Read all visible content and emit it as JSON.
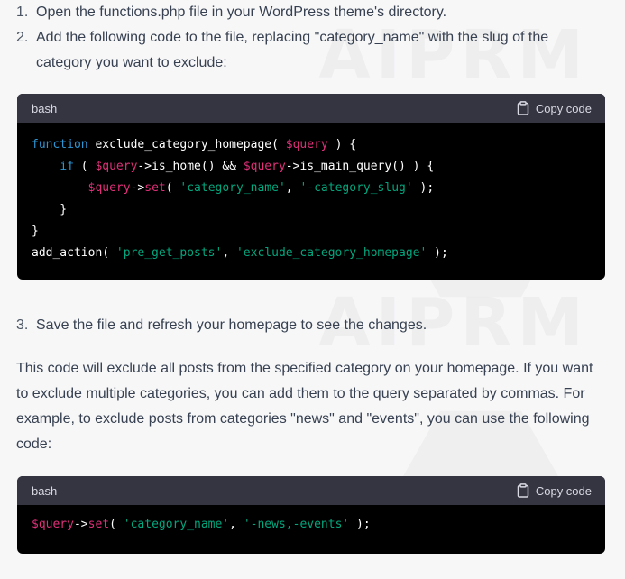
{
  "steps_top": [
    {
      "num": "1.",
      "text": "Open the functions.php file in your WordPress theme's directory."
    },
    {
      "num": "2.",
      "text": "Add the following code to the file, replacing \"category_name\" with the slug of the category you want to exclude:"
    }
  ],
  "code_block_1": {
    "lang": "bash",
    "copy_label": "Copy code",
    "lines": [
      [
        {
          "t": "k",
          "v": "function"
        },
        {
          "t": "p",
          "v": " exclude_category_homepage( "
        },
        {
          "t": "v",
          "v": "$query"
        },
        {
          "t": "p",
          "v": " ) {"
        }
      ],
      [
        {
          "t": "p",
          "v": "    "
        },
        {
          "t": "k",
          "v": "if"
        },
        {
          "t": "p",
          "v": " ( "
        },
        {
          "t": "v",
          "v": "$query"
        },
        {
          "t": "p",
          "v": "->is_home() && "
        },
        {
          "t": "v",
          "v": "$query"
        },
        {
          "t": "p",
          "v": "->is_main_query() ) {"
        }
      ],
      [
        {
          "t": "p",
          "v": "        "
        },
        {
          "t": "v",
          "v": "$query"
        },
        {
          "t": "p",
          "v": "->"
        },
        {
          "t": "v",
          "v": "set"
        },
        {
          "t": "p",
          "v": "( "
        },
        {
          "t": "s",
          "v": "'category_name'"
        },
        {
          "t": "p",
          "v": ", "
        },
        {
          "t": "s",
          "v": "'-category_slug'"
        },
        {
          "t": "p",
          "v": " );"
        }
      ],
      [
        {
          "t": "p",
          "v": "    }"
        }
      ],
      [
        {
          "t": "p",
          "v": "}"
        }
      ],
      [
        {
          "t": "p",
          "v": "add_action( "
        },
        {
          "t": "s",
          "v": "'pre_get_posts'"
        },
        {
          "t": "p",
          "v": ", "
        },
        {
          "t": "s",
          "v": "'exclude_category_homepage'"
        },
        {
          "t": "p",
          "v": " );"
        }
      ]
    ]
  },
  "steps_bottom": [
    {
      "num": "3.",
      "text": "Save the file and refresh your homepage to see the changes."
    }
  ],
  "paragraph": "This code will exclude all posts from the specified category on your homepage. If you want to exclude multiple categories, you can add them to the query separated by commas. For example, to exclude posts from categories \"news\" and \"events\", you can use the following code:",
  "code_block_2": {
    "lang": "bash",
    "copy_label": "Copy code",
    "lines": [
      [
        {
          "t": "v",
          "v": "$query"
        },
        {
          "t": "p",
          "v": "->"
        },
        {
          "t": "v",
          "v": "set"
        },
        {
          "t": "p",
          "v": "( "
        },
        {
          "t": "s",
          "v": "'category_name'"
        },
        {
          "t": "p",
          "v": ", "
        },
        {
          "t": "s",
          "v": "'-news,-events'"
        },
        {
          "t": "p",
          "v": " );"
        }
      ]
    ]
  },
  "watermark": "AIPRM",
  "colors": {
    "page_bg": "#f7f7f8",
    "code_bg": "#000000",
    "code_header_bg": "#343541",
    "keyword": "#2e95d3",
    "variable": "#df3079",
    "string": "#00a67d"
  },
  "icons": [
    "clipboard-icon"
  ]
}
